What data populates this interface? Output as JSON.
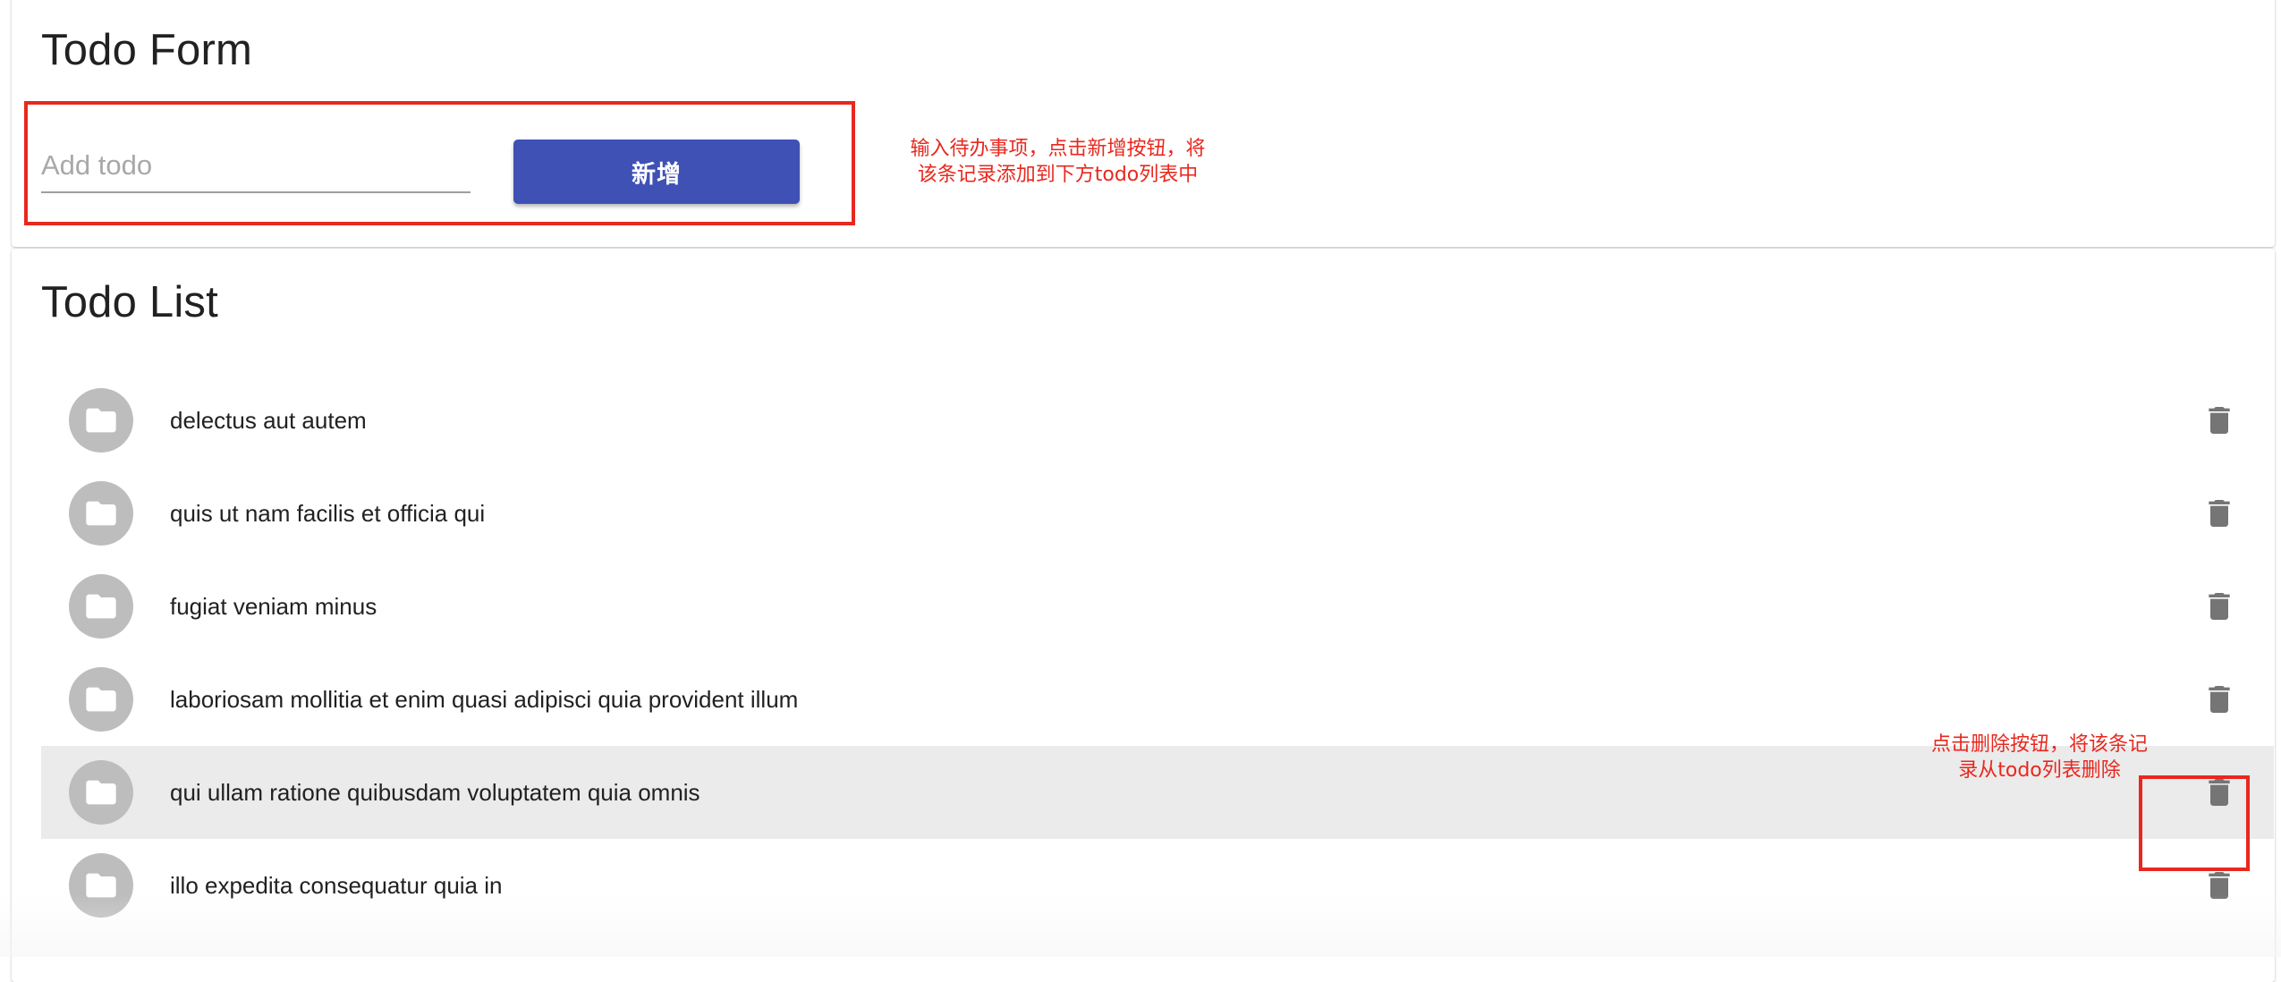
{
  "form": {
    "title": "Todo Form",
    "input_placeholder": "Add todo",
    "input_value": "",
    "add_button_label": "新增"
  },
  "list": {
    "title": "Todo List",
    "items": [
      {
        "text": "delectus aut autem"
      },
      {
        "text": "quis ut nam facilis et officia qui"
      },
      {
        "text": "fugiat veniam minus"
      },
      {
        "text": "laboriosam mollitia et enim quasi adipisci quia provident illum"
      },
      {
        "text": "qui ullam ratione quibusdam voluptatem quia omnis",
        "highlighted": true
      },
      {
        "text": "illo expedita consequatur quia in"
      }
    ]
  },
  "annotations": {
    "form_note_line1": "输入待办事项，点击新增按钮，将",
    "form_note_line2": "该条记录添加到下方todo列表中",
    "delete_note_line1": "点击删除按钮，将该条记",
    "delete_note_line2": "录从todo列表删除"
  },
  "icons": {
    "avatar": "folder-icon",
    "delete": "trash-icon"
  },
  "colors": {
    "primary": "#3f51b5",
    "annotation": "#e8281e",
    "avatar_bg": "#bdbdbd",
    "icon_gray": "#757575",
    "highlight_row": "#ebebeb"
  }
}
